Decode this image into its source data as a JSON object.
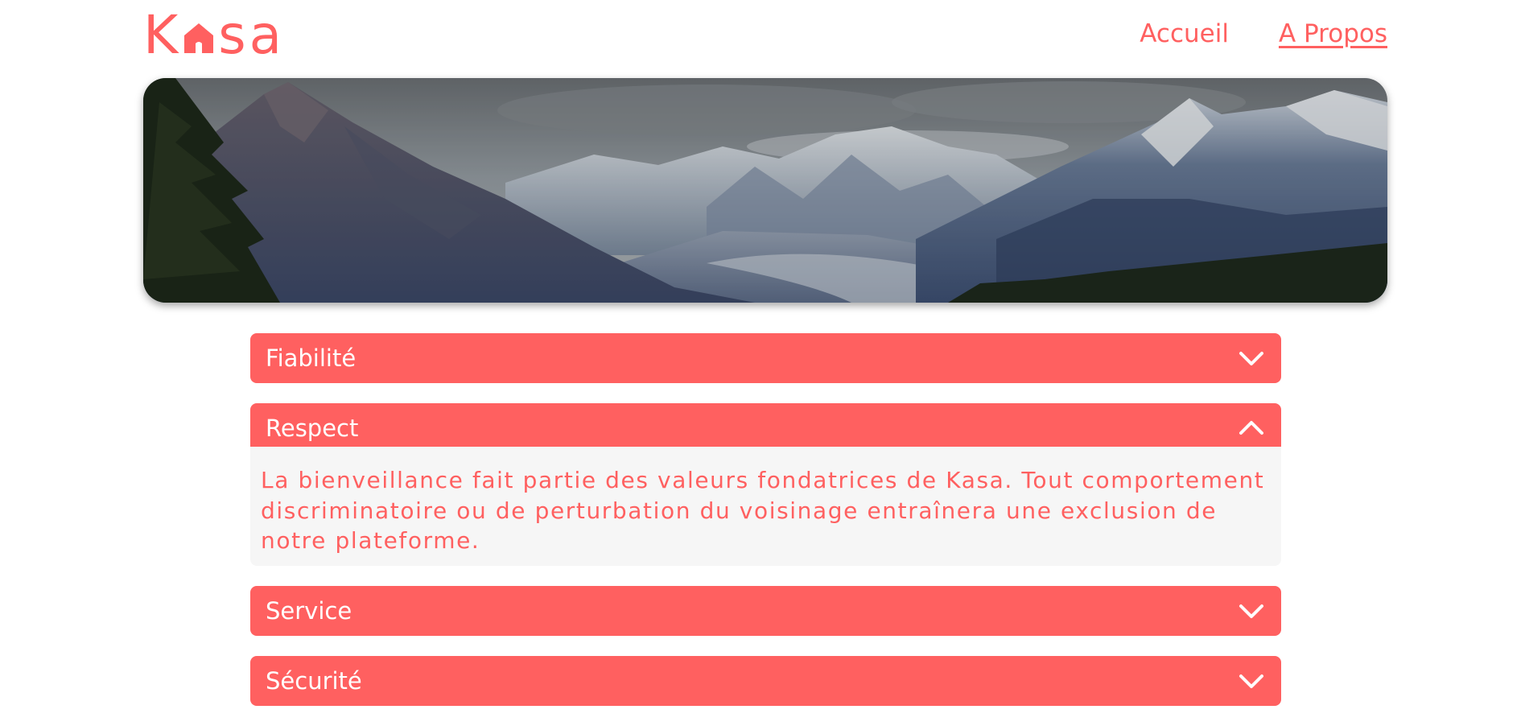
{
  "header": {
    "logo_text_left": "K",
    "logo_text_right": "sa",
    "brand_color": "#ff6060",
    "nav": [
      {
        "label": "Accueil",
        "active": false
      },
      {
        "label": "A Propos",
        "active": true
      }
    ]
  },
  "banner": {
    "image": "mountain-landscape"
  },
  "collapses": [
    {
      "title": "Fiabilité",
      "open": false,
      "icon": "chevron-down-icon"
    },
    {
      "title": "Respect",
      "open": true,
      "icon": "chevron-up-icon",
      "text": "La bienveillance fait partie des valeurs fondatrices de Kasa. Tout comportement discriminatoire ou de perturbation du voisinage entraînera une exclusion de notre plateforme."
    },
    {
      "title": "Service",
      "open": false,
      "icon": "chevron-down-icon"
    },
    {
      "title": "Sécurité",
      "open": false,
      "icon": "chevron-down-icon"
    }
  ]
}
